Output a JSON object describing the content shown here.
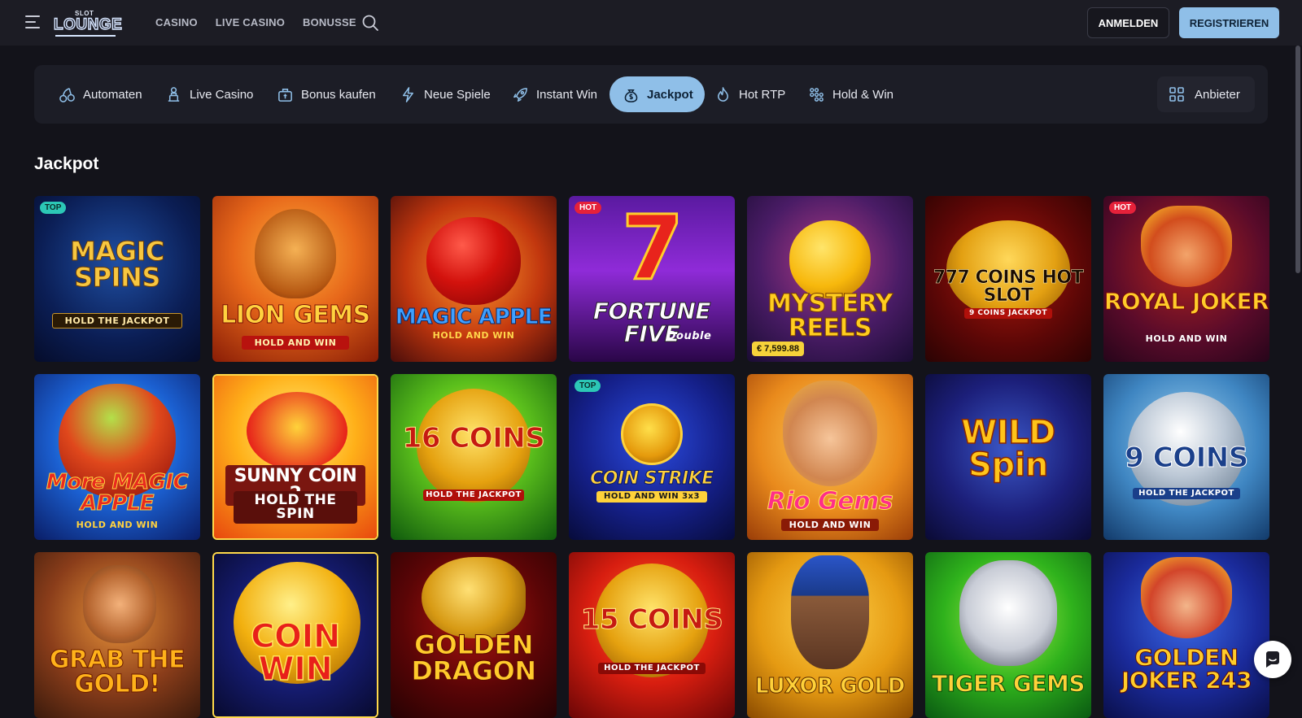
{
  "header": {
    "logo_top": "SLOT",
    "logo_main": "LOUNGE",
    "nav": [
      "CASINO",
      "LIVE CASINO",
      "BONUSSE"
    ],
    "login_label": "ANMELDEN",
    "register_label": "REGISTRIEREN"
  },
  "categories": [
    {
      "label": "Automaten",
      "icon": "cherries-icon"
    },
    {
      "label": "Live Casino",
      "icon": "dealer-icon"
    },
    {
      "label": "Bonus kaufen",
      "icon": "bonus-bag-icon"
    },
    {
      "label": "Neue Spiele",
      "icon": "lightning-icon"
    },
    {
      "label": "Instant Win",
      "icon": "rocket-icon"
    },
    {
      "label": "Jackpot",
      "icon": "money-bag-icon",
      "active": true
    },
    {
      "label": "Hot RTP",
      "icon": "flame-icon"
    },
    {
      "label": "Hold & Win",
      "icon": "dots-grid-icon"
    }
  ],
  "provider_label": "Anbieter",
  "section_title": "Jackpot",
  "colors": {
    "accent": "#8fbfe8",
    "background": "#13131a",
    "panel": "#1c1d26",
    "top_badge": "#2cc7b6",
    "hot_badge": "#e5213a"
  },
  "games": [
    {
      "line1": "MAGIC SPINS",
      "line2": "HOLD THE JACKPOT",
      "badge": "TOP"
    },
    {
      "line1": "LION GEMS",
      "line2": "HOLD AND WIN"
    },
    {
      "line1": "MAGIC APPLE",
      "line2": "HOLD AND WIN"
    },
    {
      "line1": "FORTUNE FIVE",
      "line2": "Double",
      "badge": "HOT"
    },
    {
      "line1": "MYSTERY REELS",
      "line2": "",
      "jackpot": "€ 7,599.88"
    },
    {
      "line1": "777 COINS HOT SLOT",
      "line2": "9 COINS JACKPOT"
    },
    {
      "line1": "ROYAL JOKER",
      "line2": "HOLD AND WIN",
      "badge": "HOT"
    },
    {
      "line1": "More MAGIC APPLE",
      "line2": "HOLD AND WIN"
    },
    {
      "line1": "SUNNY COIN 2",
      "line2": "HOLD THE SPIN"
    },
    {
      "line1": "16 COINS",
      "line2": "HOLD THE JACKPOT"
    },
    {
      "line1": "COIN STRIKE",
      "line2": "HOLD AND WIN 3x3",
      "badge": "TOP"
    },
    {
      "line1": "Rio Gems",
      "line2": "HOLD AND WIN"
    },
    {
      "line1": "WILD Spin",
      "line2": ""
    },
    {
      "line1": "9 COINS",
      "line2": "HOLD THE JACKPOT"
    },
    {
      "line1": "GRAB THE GOLD!",
      "line2": ""
    },
    {
      "line1": "COIN WIN",
      "line2": ""
    },
    {
      "line1": "GOLDEN DRAGON",
      "line2": ""
    },
    {
      "line1": "15 COINS",
      "line2": "HOLD THE JACKPOT"
    },
    {
      "line1": "LUXOR GOLD",
      "line2": ""
    },
    {
      "line1": "TIGER GEMS",
      "line2": ""
    },
    {
      "line1": "GOLDEN JOKER 243",
      "line2": ""
    }
  ]
}
